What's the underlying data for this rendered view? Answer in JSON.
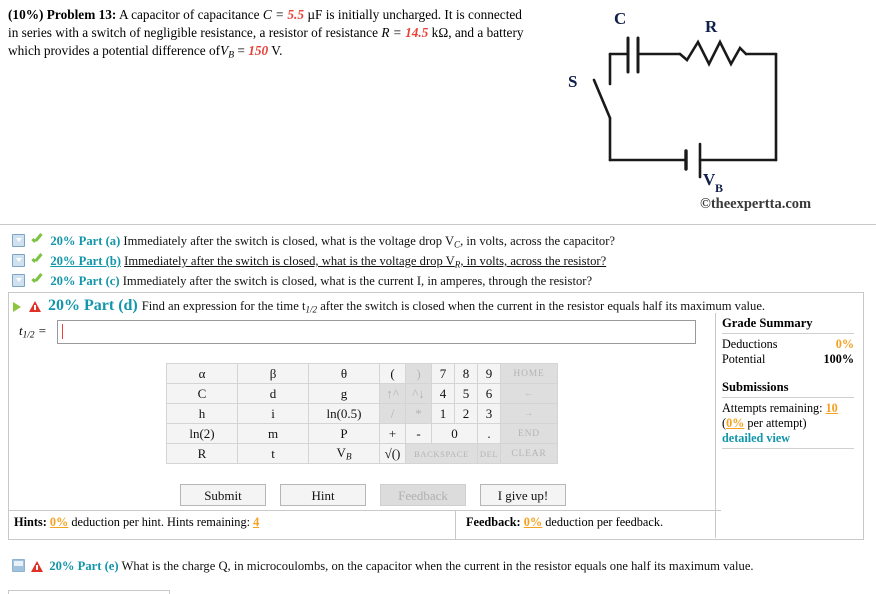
{
  "problem": {
    "weight": "(10%)",
    "title": "Problem 13:",
    "text_1": "A capacitor of capacitance",
    "var_C": "C =",
    "val_C": "5.5",
    "unit_C": "µF is initially uncharged. It is connected in series with a switch of negligible resistance, a resistor of resistance",
    "var_R": "R =",
    "val_R": "14.5",
    "unit_R": "kΩ, and a battery which provides a potential difference of",
    "var_VB": "V",
    "var_VB_sub": "B",
    "eq": "=",
    "val_VB": "150",
    "unit_VB": "V."
  },
  "circuit": {
    "label_C": "C",
    "label_R": "R",
    "label_S": "S",
    "label_V": "V",
    "label_V_sub": "B",
    "copyright": "©theexpertta.com"
  },
  "parts": [
    {
      "id": "a",
      "weight": "20%",
      "label": "Part (a)",
      "text": "Immediately after the switch is closed, what is the voltage drop V",
      "text_sub": "C",
      "text_tail": ", in volts, across the capacitor?",
      "status": "complete"
    },
    {
      "id": "b",
      "weight": "20%",
      "label": "Part (b)",
      "text": "Immediately after the switch is closed, what is the voltage drop V",
      "text_sub": "R",
      "text_tail": ", in volts, across the resistor?",
      "status": "complete"
    },
    {
      "id": "c",
      "weight": "20%",
      "label": "Part (c)",
      "text": "Immediately after the switch is closed, what is the current I, in amperes, through the resistor?",
      "text_sub": "",
      "text_tail": "",
      "status": "complete"
    }
  ],
  "active_part": {
    "id": "d",
    "weight": "20%",
    "label": "Part (d)",
    "text": "Find an expression for the time t",
    "text_sub": "1/2",
    "text_tail": " after the switch is closed when the current in the resistor equals half its maximum value.",
    "answer_label_var": "t",
    "answer_label_sub": "1/2",
    "answer_label_eq": "=",
    "answer_value": "",
    "answer_placeholder": ""
  },
  "keypad": {
    "rows": [
      [
        {
          "label": "α",
          "type": "sym",
          "disabled": false
        },
        {
          "label": "β",
          "type": "sym",
          "disabled": false
        },
        {
          "label": "θ",
          "type": "sym",
          "disabled": false
        },
        {
          "label": "(",
          "type": "op",
          "disabled": false
        },
        {
          "label": ")",
          "type": "op",
          "disabled": true
        },
        {
          "label": "7",
          "type": "num",
          "disabled": false
        },
        {
          "label": "8",
          "type": "num",
          "disabled": false
        },
        {
          "label": "9",
          "type": "num",
          "disabled": false
        },
        {
          "label": "HOME",
          "type": "nav",
          "disabled": true
        }
      ],
      [
        {
          "label": "C",
          "type": "sym",
          "disabled": false
        },
        {
          "label": "d",
          "type": "sym",
          "disabled": false
        },
        {
          "label": "g",
          "type": "sym",
          "disabled": false
        },
        {
          "label": "↑^",
          "type": "op",
          "disabled": true
        },
        {
          "label": "^↓",
          "type": "op",
          "disabled": true
        },
        {
          "label": "4",
          "type": "num",
          "disabled": false
        },
        {
          "label": "5",
          "type": "num",
          "disabled": false
        },
        {
          "label": "6",
          "type": "num",
          "disabled": false
        },
        {
          "label": "←",
          "type": "nav",
          "disabled": true
        }
      ],
      [
        {
          "label": "h",
          "type": "sym",
          "disabled": false
        },
        {
          "label": "i",
          "type": "sym",
          "disabled": false
        },
        {
          "label": "ln(0.5)",
          "type": "sym",
          "disabled": false
        },
        {
          "label": "/",
          "type": "op",
          "disabled": true
        },
        {
          "label": "*",
          "type": "op",
          "disabled": true
        },
        {
          "label": "1",
          "type": "num",
          "disabled": false
        },
        {
          "label": "2",
          "type": "num",
          "disabled": false
        },
        {
          "label": "3",
          "type": "num",
          "disabled": false
        },
        {
          "label": "→",
          "type": "nav",
          "disabled": true
        }
      ],
      [
        {
          "label": "ln(2)",
          "type": "sym",
          "disabled": false
        },
        {
          "label": "m",
          "type": "sym",
          "disabled": false
        },
        {
          "label": "P",
          "type": "sym",
          "disabled": false
        },
        {
          "label": "+",
          "type": "op",
          "disabled": false
        },
        {
          "label": "-",
          "type": "op",
          "disabled": false
        },
        {
          "label": "0",
          "type": "num2",
          "disabled": false
        },
        {
          "label": ".",
          "type": "num",
          "disabled": false
        },
        {
          "label": "END",
          "type": "nav",
          "disabled": true
        }
      ],
      [
        {
          "label": "R",
          "type": "sym",
          "disabled": false
        },
        {
          "label": "t",
          "type": "sym",
          "disabled": false
        },
        {
          "label": "V",
          "type": "symsub",
          "sub": "B",
          "disabled": false
        },
        {
          "label": "√()",
          "type": "op",
          "disabled": false
        },
        {
          "label": "BACKSPACE",
          "type": "num3",
          "disabled": true
        },
        {
          "label": "DEL",
          "type": "num",
          "disabled": true
        },
        {
          "label": "CLEAR",
          "type": "nav",
          "disabled": true
        }
      ]
    ]
  },
  "buttons": {
    "submit": "Submit",
    "hint": "Hint",
    "feedback": "Feedback",
    "give_up": "I give up!"
  },
  "grade_summary": {
    "title": "Grade Summary",
    "deductions_label": "Deductions",
    "deductions_value": "0%",
    "potential_label": "Potential",
    "potential_value": "100%",
    "submissions_title": "Submissions",
    "attempts_label": "Attempts remaining:",
    "attempts_value": "10",
    "per_attempt_value": "0%",
    "per_attempt_label": "per attempt)",
    "per_attempt_open": "(",
    "detailed_view": "detailed view"
  },
  "hints_bar": {
    "hints_title": "Hints:",
    "hints_pct": "0%",
    "hints_text": "deduction per hint. Hints remaining:",
    "hints_remaining": "4",
    "feedback_title": "Feedback:",
    "feedback_pct": "0%",
    "feedback_text": "deduction per feedback."
  },
  "part_e": {
    "weight": "20%",
    "label": "Part (e)",
    "text": "What is the charge Q, in microcoulombs, on the capacitor when the current in the resistor equals one half its maximum value."
  },
  "colors": {
    "accent_teal": "#1396ab",
    "value_red": "#e8423a",
    "orange": "#f5a01e",
    "check_green": "#7cc243",
    "warn_red": "#e03127"
  }
}
